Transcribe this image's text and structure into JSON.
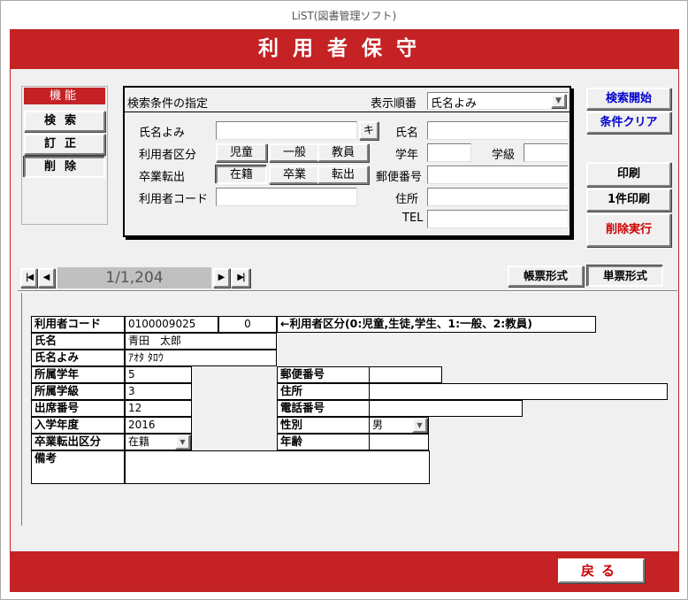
{
  "window": {
    "title": "LiST(図書管理ソフト)"
  },
  "header": {
    "title": "利用者保守"
  },
  "function_panel": {
    "heading": "機能",
    "search": "検索",
    "edit": "訂正",
    "delete": "削除"
  },
  "search_box": {
    "title": "検索条件の指定",
    "sort_label": "表示順番",
    "sort_value": "氏名よみ",
    "furigana_label": "氏名よみ",
    "ki_button": "キ",
    "user_type_label": "利用者区分",
    "user_types": [
      "児童",
      "一般",
      "教員"
    ],
    "graduation_label": "卒業転出",
    "graduation_types": [
      "在籍",
      "卒業",
      "転出"
    ],
    "user_code_label": "利用者コード",
    "name_label": "氏名",
    "grade_label": "学年",
    "class_label": "学級",
    "postal_label": "郵便番号",
    "address_label": "住所",
    "tel_label": "TEL"
  },
  "right_buttons": {
    "search_start": "検索開始",
    "clear": "条件クリア",
    "print": "印刷",
    "print_one": "1件印刷",
    "delete_exec": "削除実行"
  },
  "nav": {
    "record": "1/1,204",
    "first": "|◀",
    "prev": "◀",
    "next": "▶",
    "last": "▶|"
  },
  "view_tabs": {
    "list": "帳票形式",
    "single": "単票形式"
  },
  "record": {
    "user_code_label": "利用者コード",
    "user_code": "0100009025",
    "user_type_value": "0",
    "user_type_hint": "←利用者区分(0:児童,生徒,学生、1:一般、2:教員)",
    "name_label": "氏名",
    "name": "青田　太郎",
    "furigana_label": "氏名よみ",
    "furigana": "ｱｵﾀ ﾀﾛｳ",
    "grade_label": "所属学年",
    "grade": "5",
    "class_label": "所属学級",
    "class": "3",
    "seat_label": "出席番号",
    "seat": "12",
    "year_label": "入学年度",
    "year": "2016",
    "grad_label": "卒業転出区分",
    "grad": "在籍",
    "postal_label": "郵便番号",
    "postal": "",
    "address_label": "住所",
    "address": "",
    "phone_label": "電話番号",
    "phone": "",
    "gender_label": "性別",
    "gender": "男",
    "age_label": "年齢",
    "age": "",
    "remarks_label": "備考",
    "remarks": ""
  },
  "footer": {
    "back": "戻る"
  }
}
